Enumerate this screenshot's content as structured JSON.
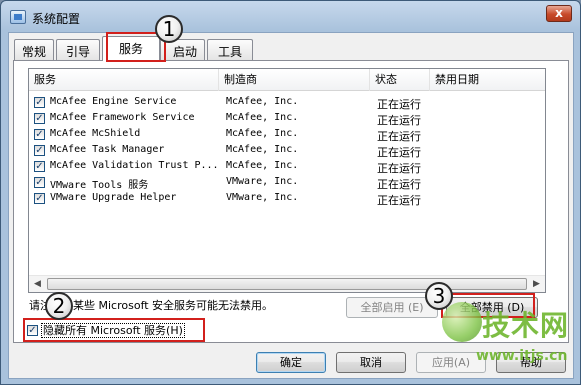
{
  "window": {
    "title": "系统配置",
    "close_glyph": "x"
  },
  "tabs": [
    {
      "label": "常规"
    },
    {
      "label": "引导"
    },
    {
      "label": "服务",
      "active": true
    },
    {
      "label": "启动"
    },
    {
      "label": "工具"
    }
  ],
  "services": {
    "columns": [
      "服务",
      "制造商",
      "状态",
      "禁用日期"
    ],
    "rows": [
      {
        "checked": true,
        "name": "McAfee Engine Service",
        "maker": "McAfee, Inc.",
        "status": "正在运行"
      },
      {
        "checked": true,
        "name": "McAfee Framework Service",
        "maker": "McAfee, Inc.",
        "status": "正在运行"
      },
      {
        "checked": true,
        "name": "McAfee McShield",
        "maker": "McAfee, Inc.",
        "status": "正在运行"
      },
      {
        "checked": true,
        "name": "McAfee Task Manager",
        "maker": "McAfee, Inc.",
        "status": "正在运行"
      },
      {
        "checked": true,
        "name": "McAfee Validation Trust P...",
        "maker": "McAfee, Inc.",
        "status": "正在运行"
      },
      {
        "checked": true,
        "name": "VMware Tools 服务",
        "maker": "VMware, Inc.",
        "status": "正在运行"
      },
      {
        "checked": true,
        "name": "VMware Upgrade Helper",
        "maker": "VMware, Inc.",
        "status": "正在运行"
      }
    ]
  },
  "note": "请注意，某些 Microsoft 安全服务可能无法禁用。",
  "buttons": {
    "enable_all": "全部启用 (E)",
    "disable_all": "全部禁用 (D)",
    "ok": "确定",
    "cancel": "取消",
    "apply": "应用(A)",
    "help": "帮助"
  },
  "hide_microsoft": {
    "checked": true,
    "label": "隐藏所有 Microsoft 服务(H)"
  },
  "callouts": [
    "1",
    "2",
    "3"
  ],
  "watermark": {
    "text": "技术网",
    "url": "www.itjs.cn"
  },
  "colors": {
    "highlight_box": "#d2201c",
    "watermark": "#6fb62f"
  }
}
